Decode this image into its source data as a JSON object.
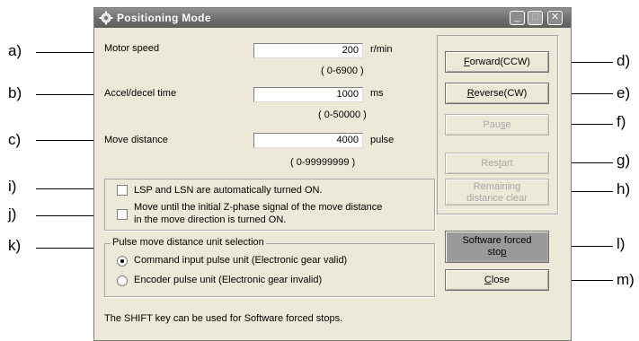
{
  "window": {
    "title": "Positioning Mode",
    "minimize_label": "_",
    "maximize_label": "□",
    "close_label": "✕"
  },
  "fields": {
    "motor_speed": {
      "label": "Motor speed",
      "value": "200",
      "unit": "r/min",
      "range": "( 0-6900 )"
    },
    "accel_decel": {
      "label": "Accel/decel time",
      "value": "1000",
      "unit": "ms",
      "range": "( 0-50000 )"
    },
    "move_distance": {
      "label": "Move distance",
      "value": "4000",
      "unit": "pulse",
      "range": "( 0-99999999 )"
    }
  },
  "options": {
    "lsp_lsn": {
      "label": "LSP and LSN are automatically turned ON.",
      "checked": false
    },
    "z_phase_line1": "Move until the initial Z-phase signal of the move distance",
    "z_phase_line2": "in the move direction is turned ON.",
    "z_phase_checked": false
  },
  "unit_group": {
    "legend": "Pulse move distance unit selection",
    "command": {
      "label": "Command input pulse unit (Electronic gear valid)",
      "selected": true
    },
    "encoder": {
      "label": "Encoder pulse unit (Electronic gear invalid)",
      "selected": false
    }
  },
  "buttons": {
    "forward": {
      "pre": "",
      "mn": "F",
      "post": "orward(CCW)"
    },
    "reverse": {
      "pre": "",
      "mn": "R",
      "post": "everse(CW)"
    },
    "pause": {
      "pre": "Pau",
      "mn": "s",
      "post": "e"
    },
    "restart": {
      "pre": "Res",
      "mn": "t",
      "post": "art"
    },
    "remaining_line1": "Remaining",
    "remaining_line2": "distance clear",
    "forced_line1": "Software forced",
    "forced_line2_pre": "sto",
    "forced_line2_mn": "p",
    "close": {
      "pre": "",
      "mn": "C",
      "post": "lose"
    }
  },
  "footer_note": "The SHIFT key can be used for Software forced stops.",
  "callouts": {
    "a": "a)",
    "b": "b)",
    "c": "c)",
    "d": "d)",
    "e": "e)",
    "f": "f)",
    "g": "g)",
    "h": "h)",
    "i": "i)",
    "j": "j)",
    "k": "k)",
    "l": "l)",
    "m": "m)"
  }
}
